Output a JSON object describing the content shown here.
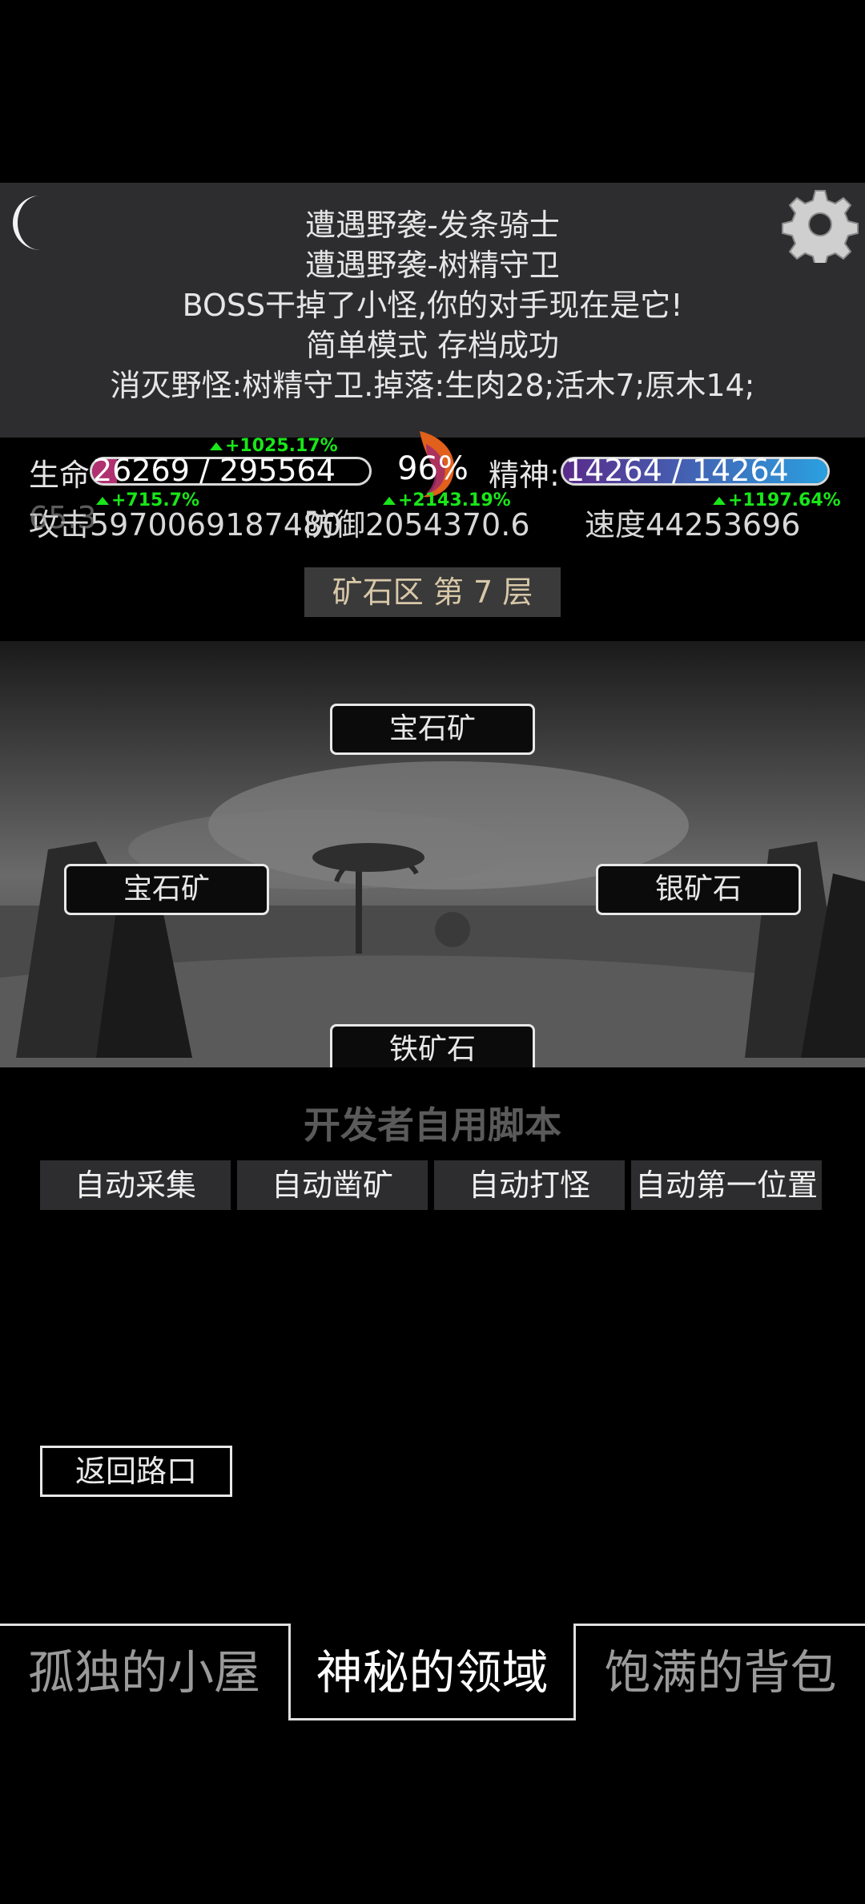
{
  "log": {
    "lines": [
      "遭遇野袭-发条骑士",
      "遭遇野袭-树精守卫",
      "BOSS干掉了小怪,你的对手现在是它!",
      "简单模式 存档成功",
      "消灭野怪:树精守卫.掉落:生肉28;活木7;原木14;"
    ]
  },
  "stats": {
    "hp_label": "生命",
    "hp_value": "26269 / 295564",
    "hp_fraction": 0.089,
    "hp_bonus": "+1025.17%",
    "center_pct": "96%",
    "spirit_label": "精神:",
    "spirit_value": "14264 / 14264",
    "spirit_fraction": 1.0,
    "attack_text": "攻击5970069187480",
    "attack_bonus": "+715.7%",
    "defense_text": "防御2054370.6",
    "defense_bonus": "+2143.19%",
    "speed_text": "速度44253696",
    "speed_bonus": "+1197.64%",
    "overlap_text": "65.3"
  },
  "location": "矿石区 第 7 层",
  "scene": {
    "nodes": [
      "宝石矿",
      "宝石矿",
      "银矿石",
      "铁矿石"
    ]
  },
  "dev": {
    "title": "开发者自用脚本",
    "buttons": [
      "自动采集",
      "自动凿矿",
      "自动打怪",
      "自动第一位置"
    ]
  },
  "return_label": "返回路口",
  "tabs": [
    "孤独的小屋",
    "神秘的领域",
    "饱满的背包"
  ],
  "colors": {
    "accent_green": "#19e619",
    "panel_bg": "#2d2d2f",
    "hp_bar": "#b03070",
    "spirit_bar_start": "#5a2a8a",
    "spirit_bar_end": "#2aa0e0"
  },
  "icons": [
    "moon-icon",
    "gear-icon",
    "flame-icon"
  ]
}
